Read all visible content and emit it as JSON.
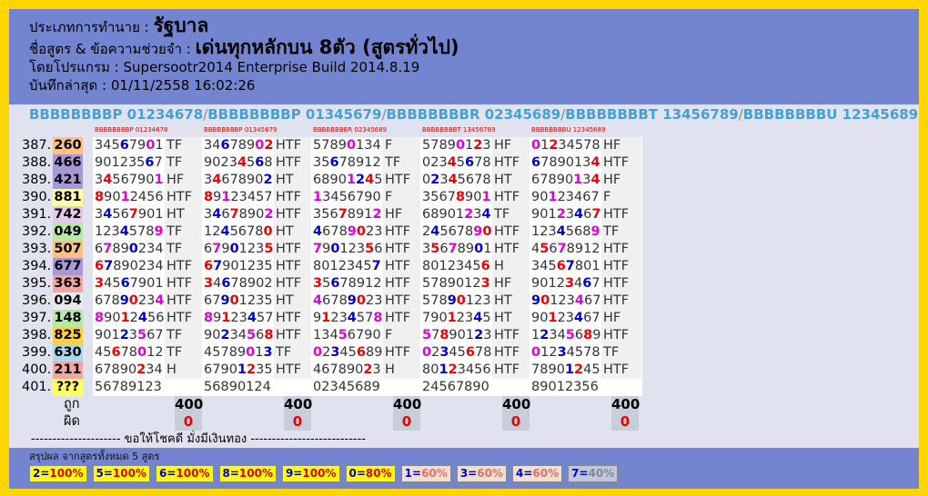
{
  "header": {
    "type_label": "ประเภทการทำนาย :",
    "type_value": "รัฐบาล",
    "formula_label": "ชื่อสูตร & ข้อความช่วยจำ :",
    "formula_value": "เด่นทุกหลักบน 8ตัว (สูตรทั่วไป)",
    "program_label": "โดยโปรแกรม :",
    "program_value": "Supersootr2014 Enterprise Build 2014.8.19",
    "saved_label": "บันทึกล่าสุด :",
    "saved_value": "01/11/2558 16:02:26"
  },
  "formula_bar": [
    "BBBBBBBBP 01234678",
    "BBBBBBBBP 01345679",
    "BBBBBBBBR 02345689",
    "BBBBBBBBT 13456789",
    "BBBBBBBBU 12345689"
  ],
  "rows": [
    {
      "no": "387.",
      "res": "260",
      "color": "#ffc080"
    },
    {
      "no": "388.",
      "res": "466",
      "color": "#a898d8"
    },
    {
      "no": "389.",
      "res": "421",
      "color": "#a898d8"
    },
    {
      "no": "390.",
      "res": "881",
      "color": "#ffffa8"
    },
    {
      "no": "391.",
      "res": "742",
      "color": "#e8c8e8"
    },
    {
      "no": "392.",
      "res": "049",
      "color": "#b8e8a8"
    },
    {
      "no": "393.",
      "res": "507",
      "color": "#ffc080"
    },
    {
      "no": "394.",
      "res": "677",
      "color": "#a898d8"
    },
    {
      "no": "395.",
      "res": "363",
      "color": "#f0a8a0"
    },
    {
      "no": "396.",
      "res": "094",
      "color": "#e8e8f0"
    },
    {
      "no": "397.",
      "res": "148",
      "color": "#b8e8a8"
    },
    {
      "no": "398.",
      "res": "825",
      "color": "#ffd040"
    },
    {
      "no": "399.",
      "res": "630",
      "color": "#a8d8f0"
    },
    {
      "no": "400.",
      "res": "211",
      "color": "#f0a8a0"
    },
    {
      "no": "401.",
      "res": "???",
      "color": "#ffff60"
    }
  ],
  "columns": [
    {
      "mini": "BBBBBBBBP 01234678",
      "cells": [
        [
          "3456790",
          "1",
          "TF"
        ],
        [
          "9012356",
          "7",
          "TF"
        ],
        [
          "3456790",
          "1",
          "HF"
        ],
        [
          "8901245",
          "6",
          "HTF"
        ],
        [
          "3456790",
          "1",
          "HT"
        ],
        [
          "1234578",
          "9",
          "TF"
        ],
        [
          "6789023",
          "4",
          "TF"
        ],
        [
          "6789023",
          "4",
          "HTF"
        ],
        [
          "3456790",
          "1",
          "HTF"
        ],
        [
          "6789023",
          "4",
          "HTF"
        ],
        [
          "8901245",
          "6",
          "HTF"
        ],
        [
          "9012356",
          "7",
          "TF"
        ],
        [
          "4567801",
          "2",
          "TF"
        ],
        [
          "6789023",
          "4",
          "H"
        ],
        [
          "5678912",
          "3",
          ""
        ]
      ],
      "sum": "400",
      "miss": "0"
    },
    {
      "mini": "BBBBBBBBP 01345679",
      "cells": [
        [
          "3467890",
          "2",
          "HTF"
        ],
        [
          "9023456",
          "8",
          "HTF"
        ],
        [
          "3467890",
          "2",
          "HT"
        ],
        [
          "8912345",
          "7",
          "HTF"
        ],
        [
          "3467890",
          "2",
          "HTF"
        ],
        [
          "1245678",
          "0",
          "HT"
        ],
        [
          "6790123",
          "5",
          "HTF"
        ],
        [
          "6790123",
          "5",
          "HTF"
        ],
        [
          "3467890",
          "2",
          "HTF"
        ],
        [
          "6790123",
          "5",
          "HT"
        ],
        [
          "8912345",
          "7",
          "HTF"
        ],
        [
          "9023456",
          "8",
          "HTF"
        ],
        [
          "4578901",
          "3",
          "TF"
        ],
        [
          "6790123",
          "5",
          "HTF"
        ],
        [
          "5689012",
          "4",
          ""
        ]
      ],
      "sum": "400",
      "miss": "0"
    },
    {
      "mini": "BBBBBBBBR 02345689",
      "cells": [
        [
          "5789013",
          "4",
          "F"
        ],
        [
          "3567891",
          "2",
          "TF"
        ],
        [
          "6890124",
          "5",
          "HTF"
        ],
        [
          "1345679",
          "0",
          "F"
        ],
        [
          "3567891",
          "2",
          "HF"
        ],
        [
          "4678902",
          "3",
          "HTF"
        ],
        [
          "7901235",
          "6",
          "HTF"
        ],
        [
          "8012345",
          "7",
          "HTF"
        ],
        [
          "3567891",
          "2",
          "HTF"
        ],
        [
          "4678902",
          "3",
          "HTF"
        ],
        [
          "9123457",
          "8",
          "HTF"
        ],
        [
          "1345679",
          "0",
          "F"
        ],
        [
          "0234568",
          "9",
          "HTF"
        ],
        [
          "4678902",
          "3",
          "H"
        ],
        [
          "0234568",
          "9",
          ""
        ]
      ],
      "sum": "400",
      "miss": "0"
    },
    {
      "mini": "BBBBBBBBT 13456789",
      "cells": [
        [
          "5789012",
          "3",
          "HF"
        ],
        [
          "0234567",
          "8",
          "HTF"
        ],
        [
          "0234567",
          "8",
          "HT"
        ],
        [
          "3567890",
          "1",
          "HTF"
        ],
        [
          "6890123",
          "4",
          "TF"
        ],
        [
          "2456789",
          "0",
          "HTF"
        ],
        [
          "3567890",
          "1",
          "HTF"
        ],
        [
          "8012345",
          "6",
          "H"
        ],
        [
          "5789012",
          "3",
          "HF"
        ],
        [
          "5789012",
          "3",
          "HT"
        ],
        [
          "7901234",
          "5",
          "HT"
        ],
        [
          "5789012",
          "3",
          "HTF"
        ],
        [
          "0234567",
          "8",
          "HTF"
        ],
        [
          "8012345",
          "6",
          "HTF"
        ],
        [
          "2456789",
          "0",
          ""
        ]
      ],
      "sum": "400",
      "miss": "0"
    },
    {
      "mini": "BBBBBBBBU 12345689",
      "cells": [
        [
          "0123457",
          "8",
          "HF"
        ],
        [
          "6789013",
          "4",
          "HTF"
        ],
        [
          "6789013",
          "4",
          "HF"
        ],
        [
          "9012346",
          "7",
          "F"
        ],
        [
          "9012346",
          "7",
          "HTF"
        ],
        [
          "1234568",
          "9",
          "TF"
        ],
        [
          "4567891",
          "2",
          "HTF"
        ],
        [
          "3456780",
          "1",
          "HTF"
        ],
        [
          "9012346",
          "7",
          "HTF"
        ],
        [
          "9012346",
          "7",
          "HTF"
        ],
        [
          "9012346",
          "7",
          "HF"
        ],
        [
          "1234568",
          "9",
          "HTF"
        ],
        [
          "0123457",
          "8",
          "TF"
        ],
        [
          "7890124",
          "5",
          "HTF"
        ],
        [
          "8901235",
          "6",
          ""
        ]
      ],
      "sum": "400",
      "miss": "0"
    }
  ],
  "labels": {
    "hit": "ถูก",
    "miss": "ผิด"
  },
  "thank": "--------------------- ขอให้โชคดี มั่งมีเงินทอง ---------------------------",
  "footer": {
    "title": "สรุปผล จากสูตรทั้งหมด 5 สูตร",
    "badges": [
      {
        "digit": "2",
        "pct": "100%",
        "bg": "#ffff00",
        "fg": "#d00"
      },
      {
        "digit": "5",
        "pct": "100%",
        "bg": "#ffff00",
        "fg": "#d00"
      },
      {
        "digit": "6",
        "pct": "100%",
        "bg": "#ffff00",
        "fg": "#d00"
      },
      {
        "digit": "8",
        "pct": "100%",
        "bg": "#ffff00",
        "fg": "#d00"
      },
      {
        "digit": "9",
        "pct": "100%",
        "bg": "#ffff00",
        "fg": "#d00"
      },
      {
        "digit": "0",
        "pct": "80%",
        "bg": "#ffff00",
        "fg": "#d00"
      },
      {
        "digit": "1",
        "pct": "60%",
        "bg": "#f0e0d0",
        "fg": "#e07070"
      },
      {
        "digit": "3",
        "pct": "60%",
        "bg": "#f0e0d0",
        "fg": "#e07070"
      },
      {
        "digit": "4",
        "pct": "60%",
        "bg": "#f0e0d0",
        "fg": "#e07070"
      },
      {
        "digit": "7",
        "pct": "40%",
        "bg": "#c0c8e0",
        "fg": "#888"
      }
    ]
  }
}
